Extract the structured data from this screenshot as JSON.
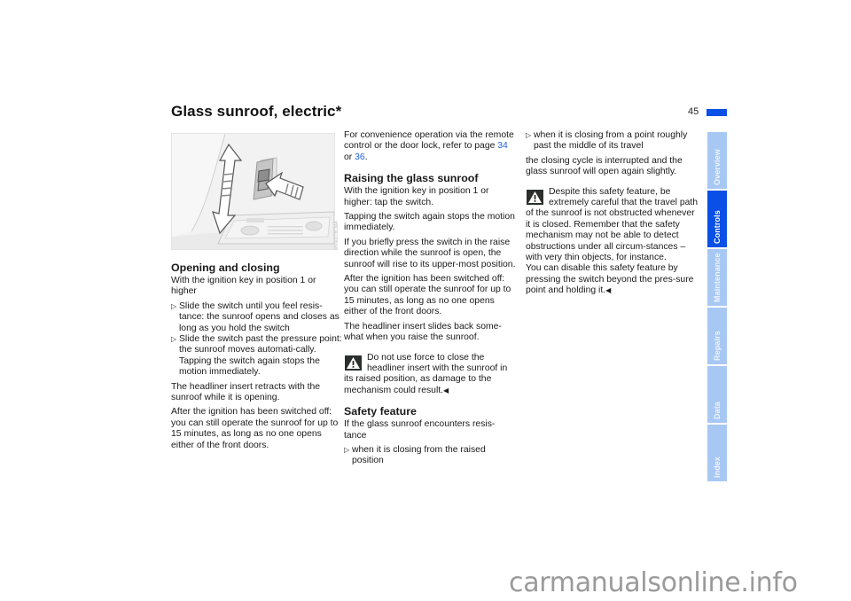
{
  "page": {
    "title": "Glass sunroof, electric*",
    "page_number": "45",
    "figure_code": "MV00078CMA"
  },
  "col1": {
    "heading": "Opening and closing",
    "intro": "With the ignition key in position 1 or higher",
    "bullets": [
      "Slide the switch until you feel resis-tance: the sunroof opens and closes as long as you hold the switch",
      "Slide the switch past the pressure point: the sunroof moves automati-cally."
    ],
    "bullet2_note": "Tapping the switch again stops the motion immediately.",
    "para1": "The headliner insert retracts with the sunroof while it is opening.",
    "para2": "After the ignition has been switched off: you can still operate the sunroof for up to 15 minutes, as long as no one opens either of the front doors."
  },
  "col2": {
    "intro_before": "For convenience operation via the remote control or the door lock, refer to page ",
    "link1": "34",
    "intro_mid": " or ",
    "link2": "36",
    "intro_after": ".",
    "heading1": "Raising the glass sunroof",
    "p1": "With the ignition key in position 1 or higher: tap the switch.",
    "p2": "Tapping the switch again stops the motion immediately.",
    "p3": "If you briefly press the switch in the raise direction while the sunroof is open, the sunroof will rise to its upper-most position.",
    "p4": "After the ignition has been switched off: you can still operate the sunroof for up to 15 minutes, as long as no one opens either of the front doors.",
    "p5": "The headliner insert slides back some-what when you raise the sunroof.",
    "warning": "Do not use force to close the headliner insert with the sunroof in its raised position, as damage to the mechanism could result.",
    "heading2": "Safety feature",
    "p6": "If the glass sunroof encounters resis-tance",
    "bullet1": "when it is closing from the raised position"
  },
  "col3": {
    "bullet2": "when it is closing from a point roughly past the middle of its travel",
    "p1": "the closing cycle is interrupted and the glass sunroof will open again slightly.",
    "warning": "Despite this safety feature, be extremely careful that the travel path of the sunroof is not obstructed whenever it is closed. Remember that the safety mechanism may not be able to detect obstructions under all circum-stances – with very thin objects, for instance.",
    "warning_cont": "You can disable this safety feature by pressing the switch beyond the pres-sure point and holding it."
  },
  "symbols": {
    "bullet_arrow": "▷",
    "end_mark": "◀"
  },
  "tabs": [
    {
      "label": "Overview",
      "active": false
    },
    {
      "label": "Controls",
      "active": true
    },
    {
      "label": "Maintenance",
      "active": false
    },
    {
      "label": "Repairs",
      "active": false
    },
    {
      "label": "Data",
      "active": false
    },
    {
      "label": "Index",
      "active": false
    }
  ],
  "colors": {
    "accent": "#0a4fe6",
    "tab_inactive": "#a8c8f4",
    "link": "#1f5fe0"
  },
  "watermark": "carmanualsonline.info"
}
